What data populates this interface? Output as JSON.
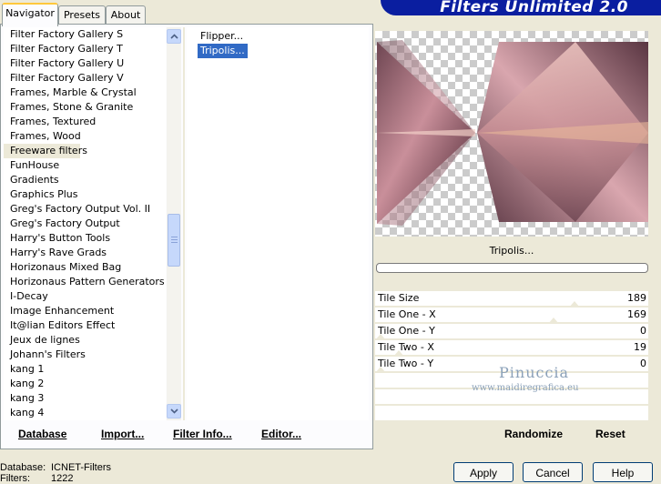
{
  "tabs": [
    "Navigator",
    "Presets",
    "About"
  ],
  "banner_title": "Filters Unlimited 2.0",
  "filter_categories": [
    "Filter Factory Gallery S",
    "Filter Factory Gallery T",
    "Filter Factory Gallery U",
    "Filter Factory Gallery V",
    "Frames, Marble & Crystal",
    "Frames, Stone & Granite",
    "Frames, Textured",
    "Frames, Wood",
    "Freeware filters",
    "FunHouse",
    "Gradients",
    "Graphics Plus",
    "Greg's Factory Output Vol. II",
    "Greg's Factory Output",
    "Harry's Button Tools",
    "Harry's Rave Grads",
    "Horizonaus Mixed Bag",
    "Horizonaus Pattern Generators",
    "I-Decay",
    "Image Enhancement",
    "It@lian Editors Effect",
    "Jeux de lignes",
    "Johann's Filters",
    "kang 1",
    "kang 2",
    "kang 3",
    "kang 4"
  ],
  "selected_category": "Freeware filters",
  "filters": [
    "Flipper...",
    "Tripolis..."
  ],
  "selected_filter": "Tripolis...",
  "preview_filter_name": "Tripolis...",
  "params": [
    {
      "label": "Tile Size",
      "value": "189",
      "level": 0.74
    },
    {
      "label": "Tile One - X",
      "value": "169",
      "level": 0.66
    },
    {
      "label": "Tile One - Y",
      "value": "0",
      "level": 0
    },
    {
      "label": "Tile Two - X",
      "value": "19",
      "level": 0.07
    },
    {
      "label": "Tile Two - Y",
      "value": "0",
      "level": 0
    }
  ],
  "watermark": {
    "name": "Pinuccia",
    "url": "www.maidiregrafica.eu"
  },
  "actions": {
    "database": "Database",
    "import": "Import...",
    "filter_info": "Filter Info...",
    "editor": "Editor...",
    "randomize": "Randomize",
    "reset": "Reset"
  },
  "status": {
    "database_label": "Database:",
    "database_value": "ICNET-Filters",
    "filters_label": "Filters:",
    "filters_value": "1222"
  },
  "buttons": {
    "apply": "Apply",
    "cancel": "Cancel",
    "help": "Help"
  },
  "colors": {
    "banner": "#0a1ea0",
    "selection": "#316ac5",
    "tab_accent": "#ffc83c"
  }
}
